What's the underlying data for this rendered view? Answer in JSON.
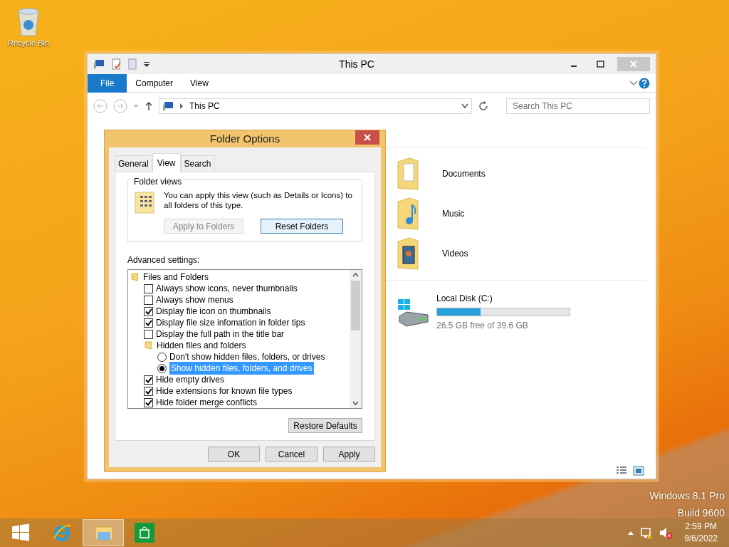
{
  "desktop_icons": [
    {
      "label": "Recycle Bin"
    }
  ],
  "explorer": {
    "title": "This PC",
    "file_tab": "File",
    "ribbon_tabs": [
      "Computer",
      "View"
    ],
    "address": "This PC",
    "search": {
      "placeholder": "Search This PC"
    },
    "folders": [
      {
        "name": "Documents",
        "kind": "documents"
      },
      {
        "name": "Music",
        "kind": "music"
      },
      {
        "name": "Videos",
        "kind": "videos"
      }
    ],
    "drives": [
      {
        "name": "Local Disk (C:)",
        "level": 0.33,
        "reading": "26.5 GB free of 39.6 GB"
      }
    ]
  },
  "dialog": {
    "title": "Folder Options",
    "tabs": [
      {
        "label": "General",
        "selected": false
      },
      {
        "label": "View",
        "selected": true
      },
      {
        "label": "Search",
        "selected": false
      }
    ],
    "folder_views": {
      "legend": "Folder views",
      "text": "You can apply this view (such as Details or Icons) to all folders of this type.",
      "buttons": [
        {
          "label": "Apply to Folders",
          "disabled": true
        },
        {
          "label": "Reset Folders",
          "disabled": false
        }
      ]
    },
    "advanced_label": "Advanced settings:",
    "settings": [
      {
        "kind": "folder",
        "label": "Files and Folders",
        "children": [
          {
            "kind": "checkbox",
            "label": "Always show icons, never thumbnails",
            "checked": false,
            "selected": false
          },
          {
            "kind": "checkbox",
            "label": "Always show menus",
            "checked": false,
            "selected": false
          },
          {
            "kind": "checkbox",
            "label": "Display file icon on thumbnails",
            "checked": true,
            "selected": false
          },
          {
            "kind": "checkbox",
            "label": "Display file size infomation in folder tips",
            "checked": true,
            "selected": false
          },
          {
            "kind": "checkbox",
            "label": "Display the full path in the title bar",
            "checked": false,
            "selected": false
          },
          {
            "kind": "folder",
            "label": "Hidden files and folders",
            "children": [
              {
                "kind": "radio",
                "label": "Don't show hidden files, folders, or drives",
                "checked": false,
                "selected": false
              },
              {
                "kind": "radio",
                "label": "Show hidden files, folders, and drives",
                "checked": true,
                "selected": true
              }
            ]
          },
          {
            "kind": "checkbox",
            "label": "Hide empty drives",
            "checked": true,
            "selected": false
          },
          {
            "kind": "checkbox",
            "label": "Hide extensions for known file types",
            "checked": true,
            "selected": false
          },
          {
            "kind": "checkbox",
            "label": "Hide folder merge conflicts",
            "checked": true,
            "selected": false
          }
        ]
      }
    ],
    "restore_button": "Restore Defaults",
    "buttons": [
      "OK",
      "Cancel",
      "Apply"
    ]
  },
  "watermark": [
    "Windows 8.1 Pro",
    "Build 9600"
  ],
  "taskbar": {
    "apps": [
      {
        "kind": "start",
        "active": false
      },
      {
        "kind": "browser",
        "active": false
      },
      {
        "kind": "explorer",
        "active": true
      },
      {
        "kind": "store",
        "active": false
      }
    ],
    "time": "2:59 PM",
    "date": "9/6/2022"
  }
}
